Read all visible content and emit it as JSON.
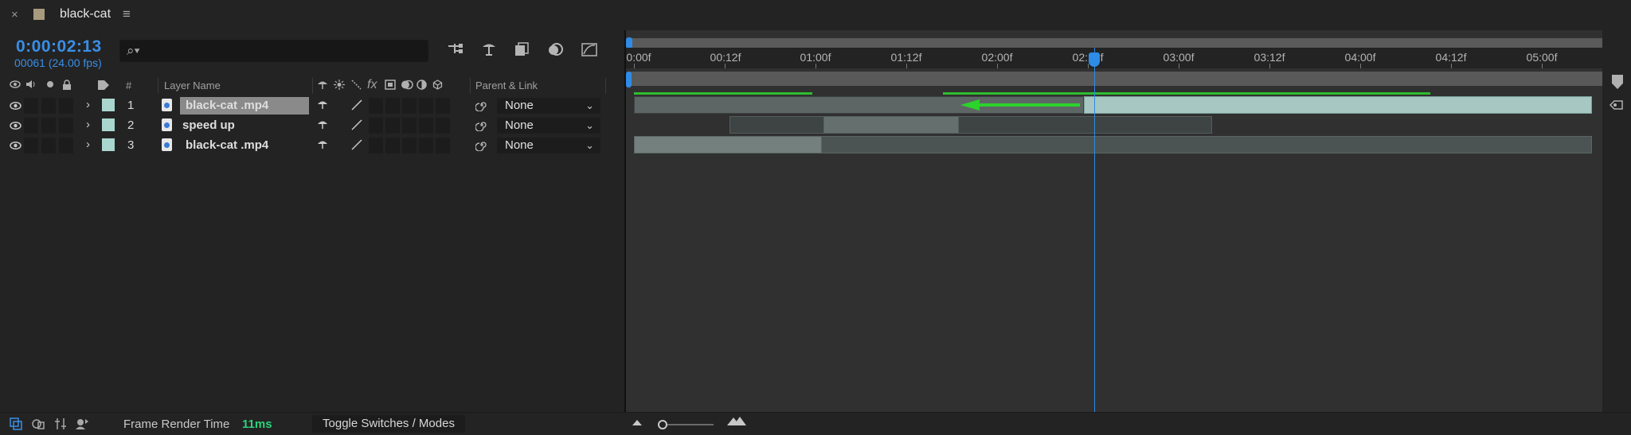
{
  "tab": {
    "close": "×",
    "title": "black-cat",
    "menu": "≡",
    "swatch_color": "#a99a7e"
  },
  "comp": {
    "timecode": "0:00:02:13",
    "frames": "00061 (24.00 fps)",
    "search_placeholder": ""
  },
  "columns": {
    "hash": "#",
    "layer_name": "Layer Name",
    "parent_link": "Parent & Link",
    "fx": "fx"
  },
  "layers": [
    {
      "num": "1",
      "name": "black-cat .mp4",
      "parent": "None",
      "label_color": "#a9d6cf",
      "selected": true
    },
    {
      "num": "2",
      "name": "speed up",
      "parent": "None",
      "label_color": "#a9d6cf",
      "selected": false
    },
    {
      "num": "3",
      "name": "black-cat .mp4",
      "parent": "None",
      "label_color": "#a9d6cf",
      "selected": false
    }
  ],
  "ruler": {
    "labels": [
      "0:00f",
      "00:12f",
      "01:00f",
      "01:12f",
      "02:00f",
      "02:12f",
      "03:00f",
      "03:12f",
      "04:00f",
      "04:12f",
      "05:00f"
    ],
    "playhead_time": "02:13f"
  },
  "footer": {
    "frame_render_label": "Frame Render Time",
    "frame_render_value": "11ms",
    "toggle_label": "Toggle Switches / Modes"
  },
  "colors": {
    "accent": "#2e8be6",
    "green": "#2dbd2d",
    "clip_active": "#a9cfc9",
    "clip_dim": "#4f5b59"
  }
}
